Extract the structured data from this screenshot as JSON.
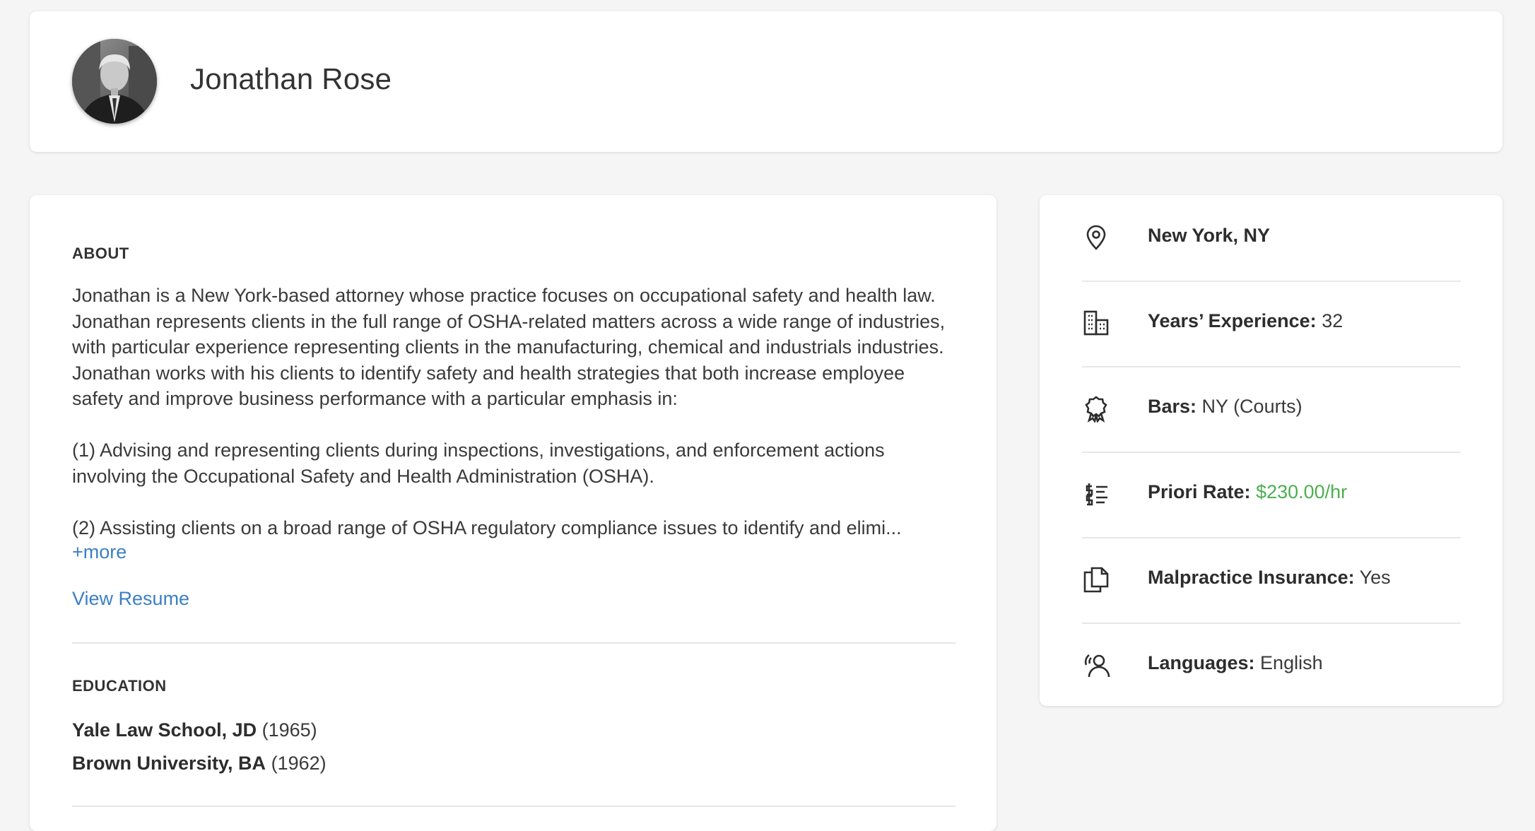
{
  "profile": {
    "name": "Jonathan Rose"
  },
  "about": {
    "title": "ABOUT",
    "paragraphs": [
      "Jonathan is a New York-based attorney whose practice focuses on occupational safety and health law. Jonathan represents clients in the full range of OSHA-related matters across a wide range of industries, with particular experience representing clients in the manufacturing, chemical and industrials industries. Jonathan works with his clients to identify safety and health strategies that both increase employee safety and improve business performance with a particular emphasis in:",
      "(1) Advising and representing clients during inspections, investigations, and enforcement actions involving the Occupational Safety and Health Administration (OSHA).",
      "(2) Assisting clients on a broad range of OSHA regulatory compliance issues to identify and elimi..."
    ],
    "more_label": "+more",
    "resume_label": "View Resume"
  },
  "education": {
    "title": "EDUCATION",
    "items": [
      {
        "school": "Yale Law School, JD",
        "year": "(1965)"
      },
      {
        "school": "Brown University, BA",
        "year": "(1962)"
      }
    ]
  },
  "details": {
    "location": "New York, NY",
    "experience_label": "Years’ Experience:",
    "experience_value": "32",
    "bars_label": "Bars:",
    "bars_value": "NY (Courts)",
    "rate_label": "Priori Rate:",
    "rate_value": "$230.00/hr",
    "insurance_label": "Malpractice Insurance:",
    "insurance_value": "Yes",
    "languages_label": "Languages:",
    "languages_value": "English"
  },
  "colors": {
    "link": "#3b7fc4",
    "rate": "#4caf50",
    "background": "#f5f5f5"
  },
  "icons": [
    "location-pin-icon",
    "building-icon",
    "award-ribbon-icon",
    "rate-list-icon",
    "documents-icon",
    "person-speaking-icon"
  ]
}
